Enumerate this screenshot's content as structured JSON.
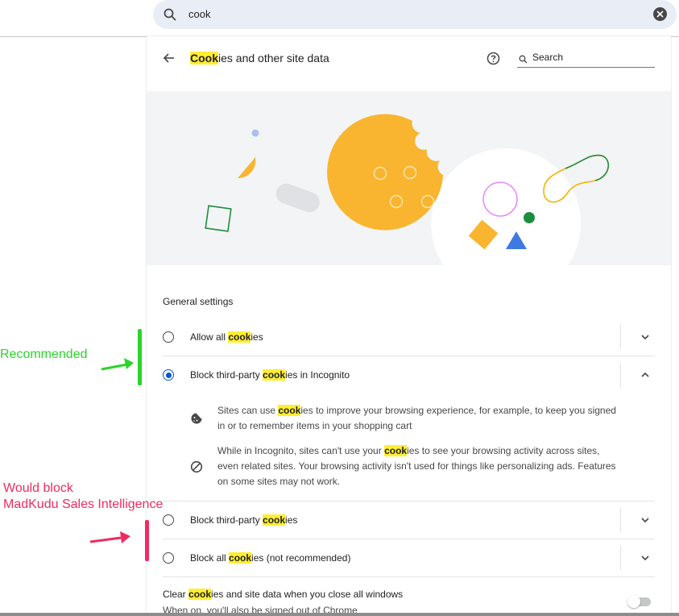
{
  "search": {
    "query": "cook"
  },
  "header": {
    "title_highlight": "Cook",
    "title_rest": "ies and other site data",
    "search_placeholder": "Search"
  },
  "general": {
    "title": "General settings",
    "options": [
      {
        "prefix": "Allow all ",
        "highlight": "cook",
        "suffix": "ies",
        "selected": false,
        "expanded": false
      },
      {
        "prefix": "Block third-party ",
        "highlight": "cook",
        "suffix": "ies in Incognito",
        "selected": true,
        "expanded": true
      },
      {
        "prefix": "Block third-party ",
        "highlight": "cook",
        "suffix": "ies",
        "selected": false,
        "expanded": false
      },
      {
        "prefix": "Block all ",
        "highlight": "cook",
        "suffix": "ies (not recommended)",
        "selected": false,
        "expanded": false
      }
    ],
    "details": [
      {
        "line1_prefix": "Sites can use ",
        "line1_highlight": "cook",
        "line1_suffix": "ies to improve your browsing experience, for example, to keep you signed",
        "line2": "in or to remember items in your shopping cart"
      },
      {
        "line1_prefix": "While in Incognito, sites can't use your ",
        "line1_highlight": "cook",
        "line1_suffix": "ies to see your browsing activity across sites,",
        "line2": "even related sites. Your browsing activity isn't used for things like personalizing ads. Features",
        "line3": "on some sites may not work."
      }
    ]
  },
  "clear_on_exit": {
    "title_prefix": "Clear ",
    "title_highlight": "cook",
    "title_suffix": "ies and site data when you close all windows",
    "subtitle": "When on, you'll also be signed out of Chrome",
    "enabled": false
  },
  "annotations": {
    "recommended": "Recommended",
    "would_block_line1": "Would block",
    "would_block_line2": "MadKudu Sales Intelligence"
  },
  "colors": {
    "accent": "#0b57d0",
    "highlight": "#ffee32",
    "annotation_green": "#2bd42b",
    "annotation_red": "#ef2b5f"
  }
}
